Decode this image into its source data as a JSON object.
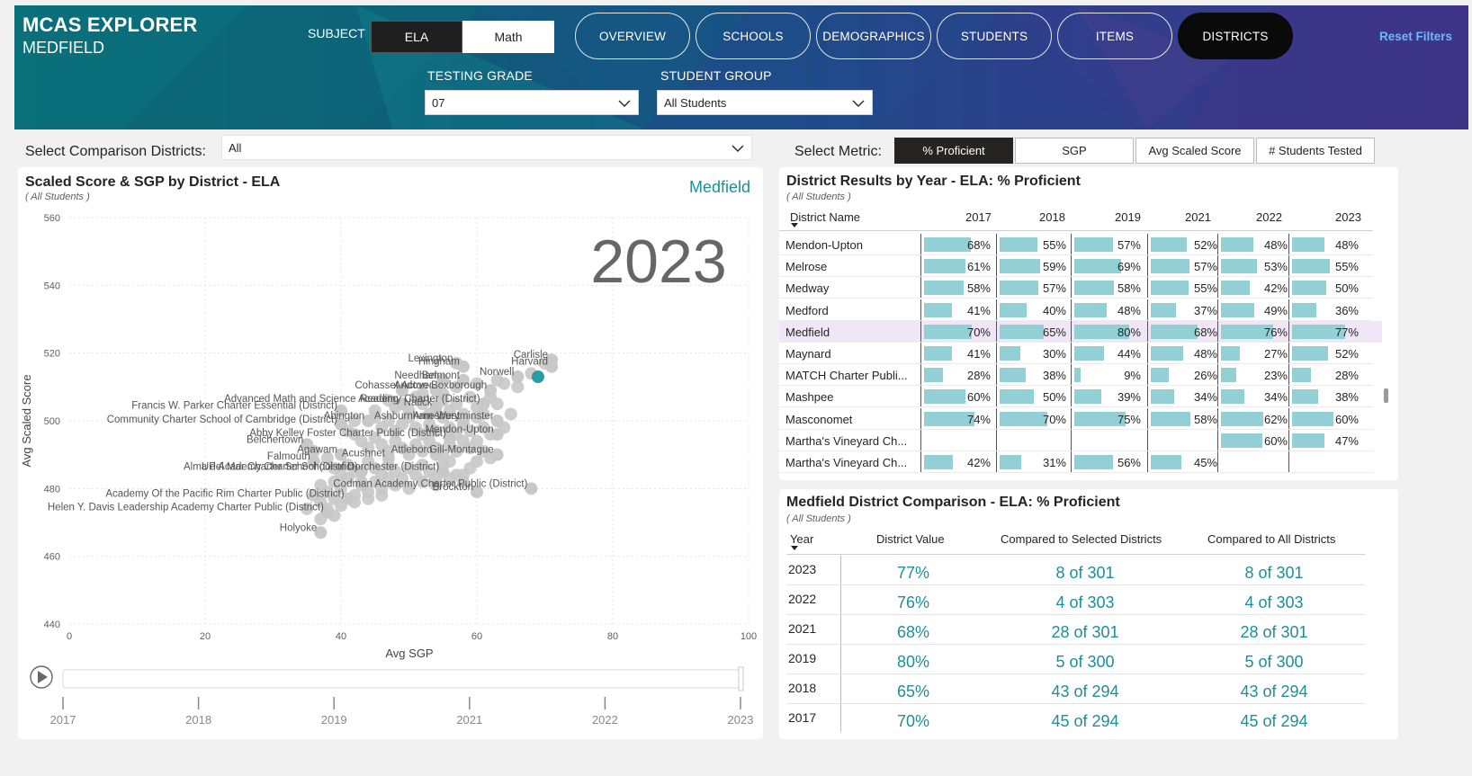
{
  "header": {
    "title": "MCAS EXPLORER",
    "subtitle": "MEDFIELD",
    "subject_label": "SUBJECT",
    "subject_options": [
      "ELA",
      "Math"
    ],
    "subject_selected": "ELA",
    "nav": [
      "OVERVIEW",
      "SCHOOLS",
      "DEMOGRAPHICS",
      "STUDENTS",
      "ITEMS",
      "DISTRICTS"
    ],
    "nav_active": "DISTRICTS",
    "reset_label": "Reset Filters",
    "grade_label": "TESTING GRADE",
    "grade_value": "07",
    "group_label": "STUDENT GROUP",
    "group_value": "All Students"
  },
  "filters": {
    "comparison_label": "Select Comparison Districts:",
    "comparison_value": "All",
    "metric_label": "Select Metric:",
    "metrics": [
      "% Proficient",
      "SGP",
      "Avg Scaled Score",
      "# Students Tested"
    ],
    "metric_active": "% Proficient"
  },
  "scatter": {
    "title": "Scaled Score & SGP by District - ELA",
    "subtitle": "( All Students )",
    "highlight_label": "Medfield",
    "year_watermark": "2023",
    "play_slider": {
      "years": [
        "2017",
        "2018",
        "2019",
        "2021",
        "2022",
        "2023"
      ],
      "selected": "2023"
    },
    "colors": {
      "points": "#c8c8c8",
      "highlight": "#2a9ba3",
      "highlight_text": "#1d8f97"
    }
  },
  "chart_data": {
    "type": "scatter",
    "xlabel": "Avg SGP",
    "ylabel": "Avg Scaled Score",
    "xlim": [
      0,
      100
    ],
    "ylim": [
      440,
      560
    ],
    "xticks": [
      "0",
      "20",
      "40",
      "60",
      "80",
      "100"
    ],
    "yticks": [
      "440",
      "460",
      "480",
      "500",
      "520",
      "540",
      "560"
    ],
    "grid": true,
    "labeled_points": [
      {
        "name": "Medfield",
        "x": 69,
        "y": 513,
        "highlight": true
      },
      {
        "name": "Lexington",
        "x": 57,
        "y": 517
      },
      {
        "name": "Hingham",
        "x": 58,
        "y": 516
      },
      {
        "name": "Carlisle",
        "x": 71,
        "y": 518
      },
      {
        "name": "Needham",
        "x": 55,
        "y": 512
      },
      {
        "name": "Belmont",
        "x": 58,
        "y": 512
      },
      {
        "name": "Norwell",
        "x": 66,
        "y": 513
      },
      {
        "name": "Harvard",
        "x": 71,
        "y": 516
      },
      {
        "name": "Cohasset",
        "x": 49,
        "y": 509
      },
      {
        "name": "Andover",
        "x": 54,
        "y": 509
      },
      {
        "name": "Acton-Boxborough",
        "x": 62,
        "y": 509
      },
      {
        "name": "Francis W. Parker Charter Essential (District)",
        "x": 40,
        "y": 503
      },
      {
        "name": "Reading",
        "x": 49,
        "y": 505
      },
      {
        "name": "Natick",
        "x": 54,
        "y": 504
      },
      {
        "name": "Advanced Math and Science Academy Charter (District)",
        "x": 61,
        "y": 505
      },
      {
        "name": "Community Charter School of Cambridge (District)",
        "x": 40,
        "y": 499
      },
      {
        "name": "Abington",
        "x": 44,
        "y": 500
      },
      {
        "name": "Amesbury",
        "x": 58,
        "y": 500
      },
      {
        "name": "Ashburnham-Westminster",
        "x": 63,
        "y": 500
      },
      {
        "name": "Abby Kelley Foster Charter Public (District)",
        "x": 56,
        "y": 495
      },
      {
        "name": "Mendon-Upton",
        "x": 63,
        "y": 496
      },
      {
        "name": "Belchertown",
        "x": 35,
        "y": 493
      },
      {
        "name": "Agawam",
        "x": 40,
        "y": 490
      },
      {
        "name": "Acushnet",
        "x": 47,
        "y": 489
      },
      {
        "name": "Attleboro",
        "x": 54,
        "y": 490
      },
      {
        "name": "Falmouth",
        "x": 36,
        "y": 488
      },
      {
        "name": "Gill-Montague",
        "x": 63,
        "y": 490
      },
      {
        "name": "Alma del Mar Charter School (District)",
        "x": 43,
        "y": 485
      },
      {
        "name": "UP Academy Charter School of Dorchester (District)",
        "x": 55,
        "y": 485
      },
      {
        "name": "Brockton",
        "x": 60,
        "y": 479
      },
      {
        "name": "Codman Academy Charter Public (District)",
        "x": 68,
        "y": 480
      },
      {
        "name": "Academy Of the Pacific Rim Charter Public (District)",
        "x": 41,
        "y": 477
      },
      {
        "name": "Helen Y. Davis Leadership Academy Charter Public (District)",
        "x": 38,
        "y": 473
      },
      {
        "name": "Holyoke",
        "x": 37,
        "y": 467
      }
    ],
    "unlabeled_points": [
      [
        47,
        506
      ],
      [
        48,
        504
      ],
      [
        50,
        503
      ],
      [
        51,
        507
      ],
      [
        52,
        505
      ],
      [
        53,
        502
      ],
      [
        55,
        506
      ],
      [
        56,
        503
      ],
      [
        57,
        505
      ],
      [
        58,
        502
      ],
      [
        59,
        507
      ],
      [
        60,
        504
      ],
      [
        61,
        502
      ],
      [
        62,
        507
      ],
      [
        63,
        505
      ],
      [
        45,
        501
      ],
      [
        46,
        498
      ],
      [
        47,
        500
      ],
      [
        48,
        497
      ],
      [
        49,
        499
      ],
      [
        50,
        501
      ],
      [
        51,
        498
      ],
      [
        52,
        496
      ],
      [
        53,
        499
      ],
      [
        54,
        497
      ],
      [
        55,
        501
      ],
      [
        56,
        498
      ],
      [
        57,
        496
      ],
      [
        58,
        499
      ],
      [
        59,
        497
      ],
      [
        60,
        501
      ],
      [
        61,
        498
      ],
      [
        62,
        496
      ],
      [
        64,
        498
      ],
      [
        65,
        502
      ],
      [
        42,
        496
      ],
      [
        43,
        494
      ],
      [
        44,
        492
      ],
      [
        45,
        495
      ],
      [
        46,
        493
      ],
      [
        47,
        491
      ],
      [
        48,
        494
      ],
      [
        49,
        492
      ],
      [
        50,
        490
      ],
      [
        51,
        493
      ],
      [
        52,
        491
      ],
      [
        53,
        494
      ],
      [
        54,
        492
      ],
      [
        55,
        490
      ],
      [
        56,
        493
      ],
      [
        57,
        491
      ],
      [
        58,
        494
      ],
      [
        59,
        492
      ],
      [
        60,
        494
      ],
      [
        61,
        491
      ],
      [
        38,
        489
      ],
      [
        39,
        486
      ],
      [
        40,
        484
      ],
      [
        41,
        487
      ],
      [
        42,
        485
      ],
      [
        43,
        482
      ],
      [
        44,
        488
      ],
      [
        45,
        486
      ],
      [
        46,
        484
      ],
      [
        47,
        487
      ],
      [
        48,
        485
      ],
      [
        49,
        483
      ],
      [
        50,
        486
      ],
      [
        51,
        484
      ],
      [
        52,
        487
      ],
      [
        53,
        485
      ],
      [
        54,
        483
      ],
      [
        55,
        487
      ],
      [
        56,
        488
      ],
      [
        57,
        484
      ],
      [
        58,
        482
      ],
      [
        59,
        486
      ],
      [
        60,
        488
      ],
      [
        62,
        489
      ],
      [
        37,
        481
      ],
      [
        38,
        479
      ],
      [
        39,
        482
      ],
      [
        40,
        480
      ],
      [
        41,
        483
      ],
      [
        42,
        478
      ],
      [
        43,
        481
      ],
      [
        44,
        479
      ],
      [
        45,
        482
      ],
      [
        46,
        480
      ],
      [
        47,
        483
      ],
      [
        48,
        481
      ],
      [
        50,
        480
      ],
      [
        52,
        482
      ],
      [
        54,
        481
      ],
      [
        56,
        483
      ],
      [
        58,
        484
      ],
      [
        36,
        478
      ],
      [
        37,
        476
      ],
      [
        38,
        474
      ],
      [
        39,
        477
      ],
      [
        40,
        475
      ],
      [
        42,
        476
      ],
      [
        44,
        477
      ],
      [
        46,
        478
      ],
      [
        35,
        474
      ],
      [
        37,
        471
      ],
      [
        39,
        472
      ],
      [
        64,
        511
      ],
      [
        66,
        510
      ],
      [
        68,
        514
      ],
      [
        70,
        517
      ],
      [
        57,
        510
      ],
      [
        60,
        511
      ],
      [
        52,
        508
      ],
      [
        55,
        508
      ],
      [
        63,
        512
      ],
      [
        45,
        503
      ],
      [
        42,
        500
      ],
      [
        41,
        497
      ],
      [
        36,
        491
      ]
    ]
  },
  "results_table": {
    "title": "District Results by Year - ELA: % Proficient",
    "subtitle": "( All Students )",
    "name_header": "District Name",
    "years": [
      "2017",
      "2018",
      "2019",
      "2021",
      "2022",
      "2023"
    ],
    "rows": [
      {
        "name": "Mendon-Upton",
        "values": [
          "68%",
          "55%",
          "57%",
          "52%",
          "48%",
          "48%"
        ],
        "pct": [
          68,
          55,
          57,
          52,
          48,
          48
        ]
      },
      {
        "name": "Melrose",
        "values": [
          "61%",
          "59%",
          "69%",
          "57%",
          "53%",
          "55%"
        ],
        "pct": [
          61,
          59,
          69,
          57,
          53,
          55
        ]
      },
      {
        "name": "Medway",
        "values": [
          "58%",
          "57%",
          "58%",
          "55%",
          "42%",
          "50%"
        ],
        "pct": [
          58,
          57,
          58,
          55,
          42,
          50
        ]
      },
      {
        "name": "Medford",
        "values": [
          "41%",
          "40%",
          "48%",
          "37%",
          "49%",
          "36%"
        ],
        "pct": [
          41,
          40,
          48,
          37,
          49,
          36
        ]
      },
      {
        "name": "Medfield",
        "values": [
          "70%",
          "65%",
          "80%",
          "68%",
          "76%",
          "77%"
        ],
        "pct": [
          70,
          65,
          80,
          68,
          76,
          77
        ],
        "highlight": true
      },
      {
        "name": "Maynard",
        "values": [
          "41%",
          "30%",
          "44%",
          "48%",
          "27%",
          "52%"
        ],
        "pct": [
          41,
          30,
          44,
          48,
          27,
          52
        ]
      },
      {
        "name": "MATCH Charter Publi...",
        "values": [
          "28%",
          "38%",
          "9%",
          "26%",
          "23%",
          "28%"
        ],
        "pct": [
          28,
          38,
          9,
          26,
          23,
          28
        ]
      },
      {
        "name": "Mashpee",
        "values": [
          "60%",
          "50%",
          "39%",
          "34%",
          "34%",
          "38%"
        ],
        "pct": [
          60,
          50,
          39,
          34,
          34,
          38
        ]
      },
      {
        "name": "Masconomet",
        "values": [
          "74%",
          "70%",
          "75%",
          "58%",
          "62%",
          "60%"
        ],
        "pct": [
          74,
          70,
          75,
          58,
          62,
          60
        ]
      },
      {
        "name": "Martha's Vineyard Ch...",
        "values": [
          "",
          "",
          "",
          "",
          "60%",
          "47%"
        ],
        "pct": [
          0,
          0,
          0,
          0,
          60,
          47
        ]
      },
      {
        "name": "Martha's Vineyard Ch...",
        "values": [
          "42%",
          "31%",
          "56%",
          "45%",
          "",
          ""
        ],
        "pct": [
          42,
          31,
          56,
          45,
          0,
          0
        ]
      }
    ]
  },
  "comparison": {
    "title": "Medfield District Comparison - ELA: % Proficient",
    "subtitle": "( All Students )",
    "headers": [
      "Year",
      "District Value",
      "Compared to Selected Districts",
      "Compared to All Districts"
    ],
    "rows": [
      {
        "year": "2023",
        "value": "77%",
        "selected": "8 of 301",
        "all": "8 of 301"
      },
      {
        "year": "2022",
        "value": "76%",
        "selected": "4 of 303",
        "all": "4 of 303"
      },
      {
        "year": "2021",
        "value": "68%",
        "selected": "28 of 301",
        "all": "28 of 301"
      },
      {
        "year": "2019",
        "value": "80%",
        "selected": "5 of 300",
        "all": "5 of 300"
      },
      {
        "year": "2018",
        "value": "65%",
        "selected": "43 of 294",
        "all": "43 of 294"
      },
      {
        "year": "2017",
        "value": "70%",
        "selected": "45 of 294",
        "all": "45 of 294"
      }
    ]
  }
}
